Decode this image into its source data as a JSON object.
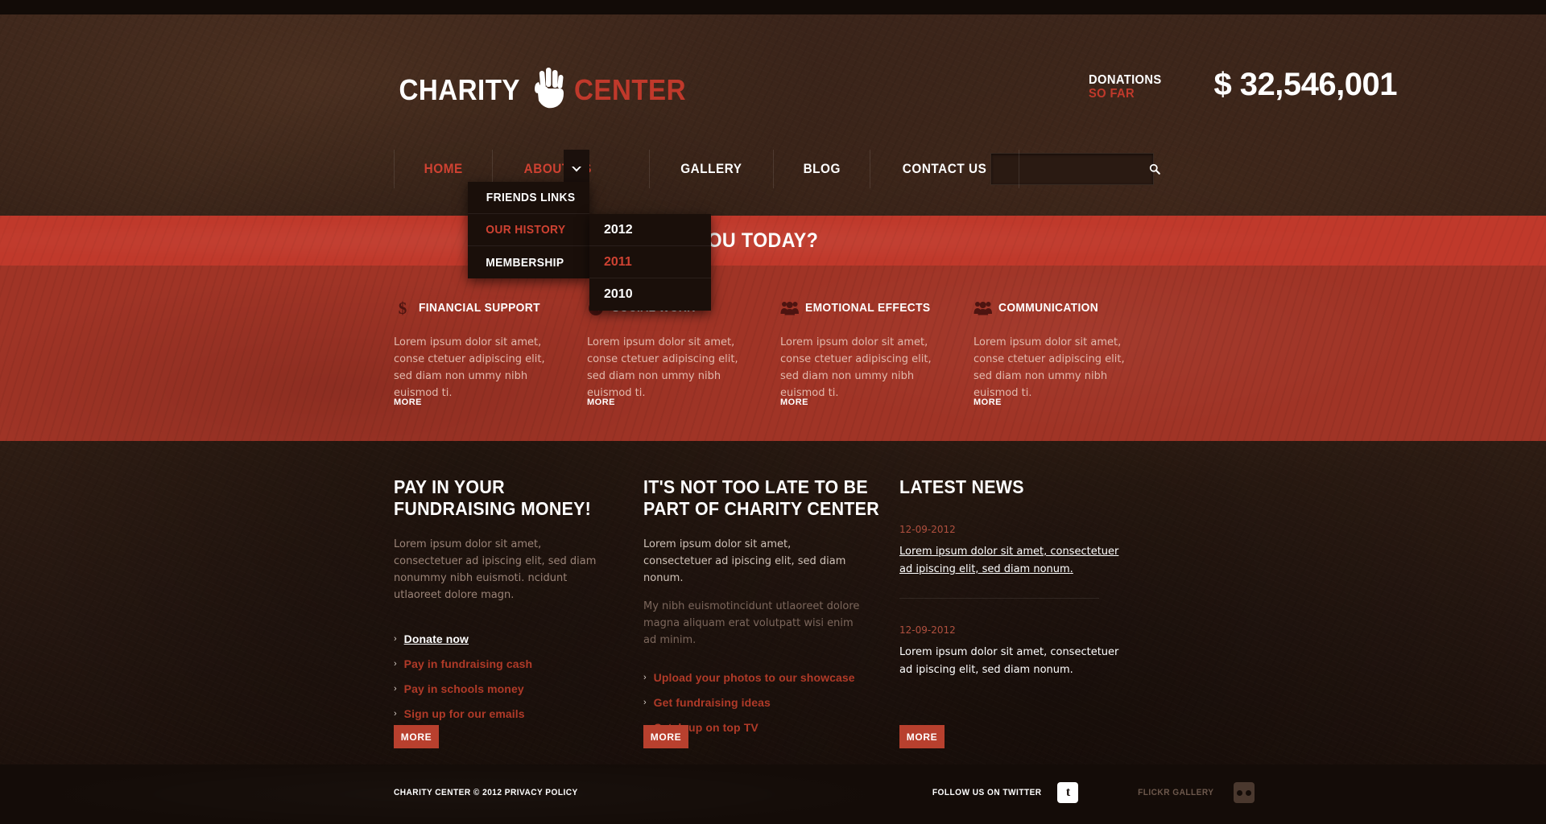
{
  "site": {
    "logo_white": "CHARITY",
    "logo_red": "CENTER",
    "logo_icon": "hand-icon"
  },
  "header": {
    "donations_label_line1": "DONATIONS",
    "donations_label_line2": "SO FAR",
    "donations_amount": "$ 32,546,001"
  },
  "nav": {
    "items": [
      {
        "label": "HOME",
        "state": "active"
      },
      {
        "label": "ABOUT US",
        "state": "active"
      },
      {
        "label": "GALLERY",
        "state": "normal"
      },
      {
        "label": "BLOG",
        "state": "normal"
      },
      {
        "label": "CONTACT US",
        "state": "normal"
      }
    ],
    "caret_icon": "chevron-down-icon"
  },
  "search": {
    "value": "",
    "placeholder": "",
    "icon": "search-icon"
  },
  "dropdown": {
    "items": [
      {
        "label": "FRIENDS LINKS",
        "state": "normal"
      },
      {
        "label": "OUR HISTORY",
        "state": "active"
      },
      {
        "label": "MEMBERSHIP",
        "state": "normal"
      }
    ]
  },
  "submenu": {
    "items": [
      {
        "label": "2012",
        "state": "normal"
      },
      {
        "label": "2011",
        "state": "active"
      },
      {
        "label": "2010",
        "state": "normal"
      }
    ]
  },
  "banner": {
    "text": "HOW CAN WE HELP YOU TODAY?"
  },
  "features": {
    "body_text": "Lorem ipsum dolor sit amet, conse ctetuer adipiscing elit, sed diam non ummy nibh euismod ti.",
    "more_label": "MORE",
    "columns": [
      {
        "title": "FINANCIAL SUPPORT",
        "icon": "dollar-icon"
      },
      {
        "title": "SOCIAL WORK",
        "icon": "clock-icon"
      },
      {
        "title": "EMOTIONAL EFFECTS",
        "icon": "people-icon"
      },
      {
        "title": "COMMUNICATION",
        "icon": "people-icon"
      }
    ]
  },
  "content": {
    "col1": {
      "title": "PAY IN YOUR FUNDRAISING MONEY!",
      "paragraph": "Lorem ipsum dolor sit amet, consectetuer ad ipiscing elit, sed diam nonummy nibh euismoti. ncidunt utlaoreet dolore magn.",
      "links": [
        {
          "label": "Donate now",
          "state": "hover"
        },
        {
          "label": "Pay in fundraising cash",
          "state": "normal"
        },
        {
          "label": "Pay in schools money",
          "state": "normal"
        },
        {
          "label": "Sign up for our emails",
          "state": "normal"
        }
      ],
      "more_label": "MORE"
    },
    "col2": {
      "title": "IT'S NOT TOO LATE TO BE PART OF CHARITY CENTER",
      "paragraph1": "Lorem ipsum dolor sit amet, consectetuer ad ipiscing elit, sed diam nonum.",
      "paragraph2": "My nibh euismotincidunt utlaoreet dolore magna aliquam erat volutpatt wisi enim ad minim.",
      "links": [
        {
          "label": "Upload your photos to our showcase",
          "state": "normal"
        },
        {
          "label": "Get fundraising ideas",
          "state": "normal"
        },
        {
          "label": "Catch up on top TV",
          "state": "normal"
        }
      ],
      "more_label": "MORE"
    },
    "col3": {
      "title": "LATEST NEWS",
      "items": [
        {
          "date": "12-09-2012",
          "text": "Lorem ipsum dolor sit amet, consectetuer ad ipiscing elit, sed diam nonum.",
          "linked": true
        },
        {
          "date": "12-09-2012",
          "text": "Lorem ipsum dolor sit amet, consectetuer ad ipiscing elit, sed diam nonum.",
          "linked": false
        }
      ],
      "more_label": "MORE"
    }
  },
  "footer": {
    "copyright": "CHARITY CENTER © 2012 PRIVACY POLICY",
    "twitter_label": "FOLLOW US ON TWITTER",
    "twitter_icon": "twitter-icon",
    "flickr_label": "FLICKR GALLERY",
    "flickr_icon": "flickr-icon"
  },
  "colors": {
    "brand_red": "#c0392b",
    "link_red": "#b03a28",
    "bg_brown": "#2d1c13",
    "features_red": "#a03426",
    "footer_dark": "#140c08"
  }
}
